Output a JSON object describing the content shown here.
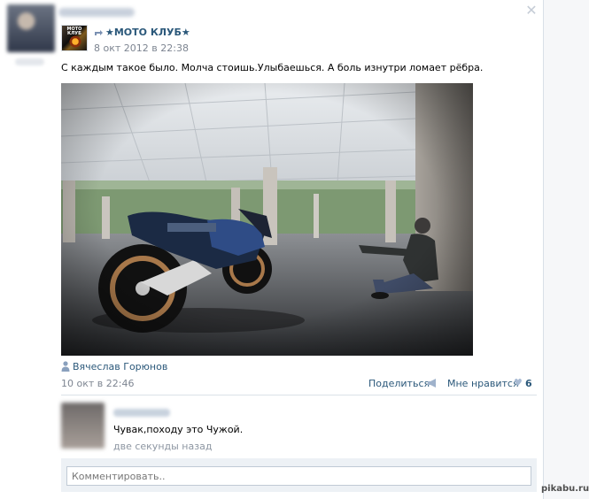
{
  "post": {
    "group_name": "★МОТО КЛУБ★",
    "date": "8 окт 2012 в 22:38",
    "text": "С каждым такое было. Молча стоишь.Улыбаешься. А боль изнутри ломает рёбра.",
    "author": "Вячеслав Горюнов",
    "time": "10 окт в 22:46",
    "share_label": "Поделиться",
    "like_label": "Мне нравится",
    "like_count": "6",
    "group_avatar_text": "МОТО КЛУБ"
  },
  "reply": {
    "text": "Чувак,походу это Чужой.",
    "time": "две секунды назад"
  },
  "comment": {
    "placeholder": "Комментировать.."
  },
  "icons": {
    "close": "close-icon",
    "share": "share-arrow-icon",
    "author": "user-icon",
    "megaphone": "megaphone-icon",
    "heart": "heart-icon"
  },
  "colors": {
    "link": "#2b587a",
    "muted": "#7d8591",
    "comment_bg": "#edf1f5"
  },
  "watermark": "pikabu.ru"
}
